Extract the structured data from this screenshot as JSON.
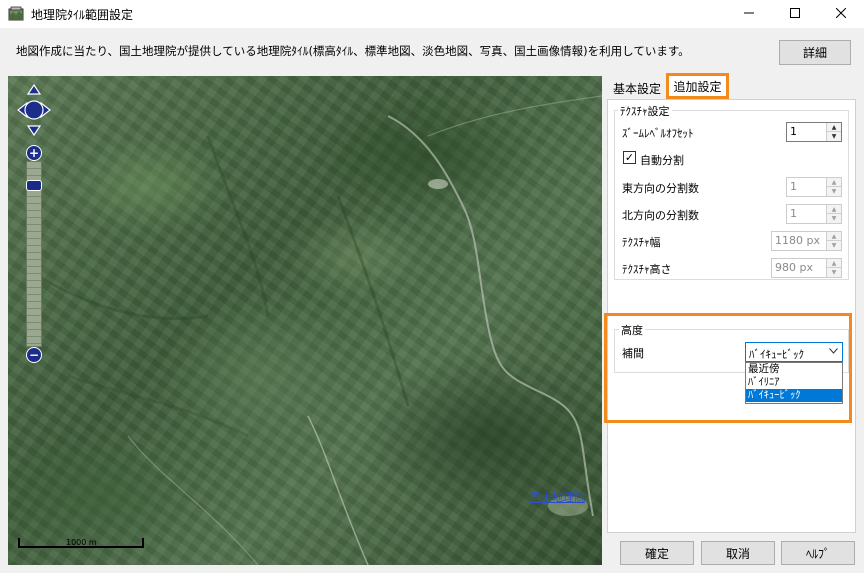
{
  "window": {
    "title": "地理院ﾀｲﾙ範囲設定",
    "minimize_icon": "minimize-icon",
    "maximize_icon": "maximize-icon",
    "close_icon": "close-icon"
  },
  "description": "地図作成に当たり、国土地理院が提供している地理院ﾀｲﾙ(標高ﾀｲﾙ、標準地図、淡色地図、写真、国土画像情報)を利用しています。",
  "detail_button": "詳細",
  "map": {
    "attribution": "国土地理院",
    "scale_label": "1000 m",
    "zoom_in": "+",
    "zoom_out": "−"
  },
  "tabs": [
    {
      "label": "基本設定",
      "active": false
    },
    {
      "label": "追加設定",
      "active": true
    }
  ],
  "texture": {
    "group_title": "ﾃｸｽﾁｬ設定",
    "zoom_offset_label": "ｽﾞｰﾑﾚﾍﾞﾙｵﾌｾｯﾄ",
    "zoom_offset_value": "1",
    "auto_split_label": "自動分割",
    "auto_split_checked": true,
    "east_split_label": "東方向の分割数",
    "east_split_value": "1",
    "north_split_label": "北方向の分割数",
    "north_split_value": "1",
    "width_label": "ﾃｸｽﾁｬ幅",
    "width_value": "1180 px",
    "height_label": "ﾃｸｽﾁｬ高さ",
    "height_value": "980 px"
  },
  "altitude": {
    "group_title": "高度",
    "interp_label": "補間",
    "interp_value": "ﾊﾞｲｷｭｰﾋﾞｯｸ",
    "options": [
      "最近傍",
      "ﾊﾞｲﾘﾆｱ",
      "ﾊﾞｲｷｭｰﾋﾞｯｸ"
    ],
    "selected_index": 2
  },
  "footer": {
    "ok": "確定",
    "cancel": "取消",
    "help": "ﾍﾙﾌﾟ"
  },
  "colors": {
    "highlight": "#f28a1e",
    "selection": "#0078d7",
    "map_control": "#1c2d8a"
  }
}
